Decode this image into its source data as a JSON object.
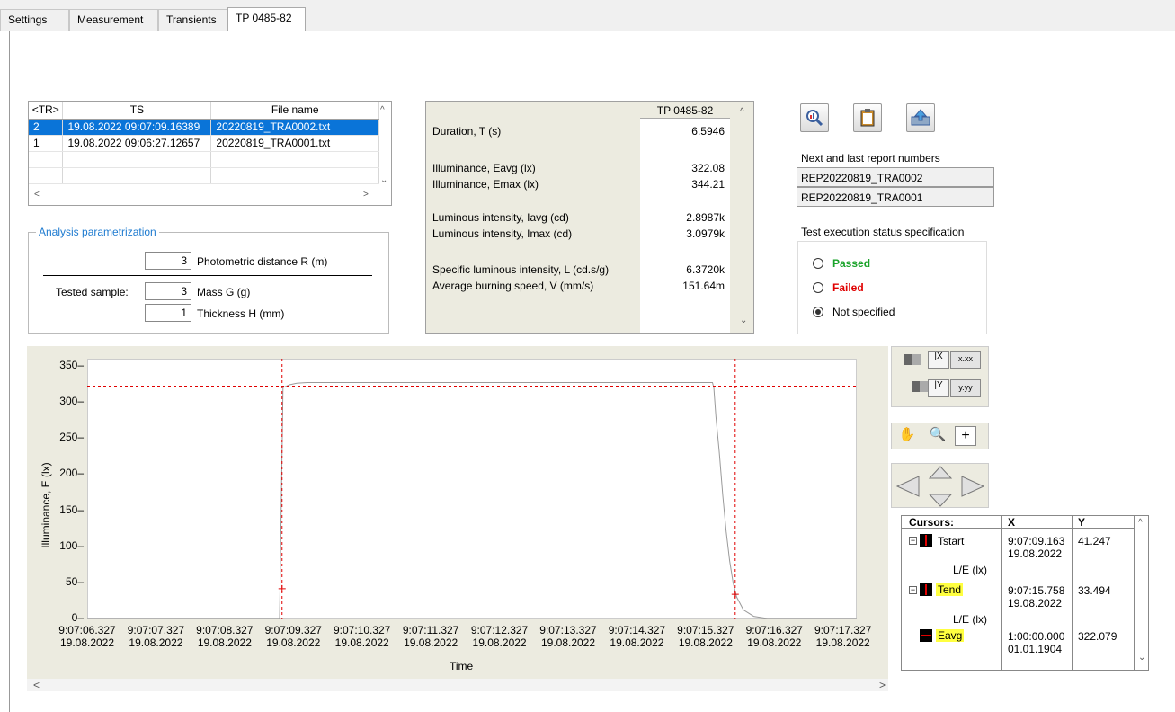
{
  "tabs": [
    "Settings",
    "Measurement",
    "Transients",
    "TP 0485-82"
  ],
  "file_table": {
    "headers": [
      "<TR>",
      "TS",
      "File name"
    ],
    "rows": [
      [
        "2",
        "19.08.2022 09:07:09.16389",
        "20220819_TRA0002.txt"
      ],
      [
        "1",
        "19.08.2022 09:06:27.12657",
        "20220819_TRA0001.txt"
      ]
    ]
  },
  "analysis": {
    "title": "Analysis parametrization",
    "distance_value": "3",
    "distance_label": "Photometric distance R (m)",
    "tested_sample_label": "Tested sample:",
    "mass_value": "3",
    "mass_label": "Mass G (g)",
    "thickness_value": "1",
    "thickness_label": "Thickness H (mm)"
  },
  "results": {
    "header": "TP 0485-82",
    "rows": [
      {
        "label": "Duration, T (s)",
        "value": "6.5946"
      },
      {
        "label": "Illuminance, Eavg (lx)",
        "value": "322.08"
      },
      {
        "label": "Illuminance, Emax (lx)",
        "value": "344.21"
      },
      {
        "label": "Luminous intensity, Iavg (cd)",
        "value": "2.8987k"
      },
      {
        "label": "Luminous intensity, Imax (cd)",
        "value": "3.0979k"
      },
      {
        "label": "Specific luminous intensity, L (cd.s/g)",
        "value": "6.3720k"
      },
      {
        "label": "Average burning speed, V (mm/s)",
        "value": "151.64m"
      }
    ]
  },
  "report": {
    "title": "Next and last report numbers",
    "next": "REP20220819_TRA0002",
    "last": "REP20220819_TRA0001"
  },
  "status": {
    "title": "Test execution status specification",
    "options": [
      "Passed",
      "Failed",
      "Not specified"
    ],
    "selected": "Not specified",
    "passed_color": "#1aa32a",
    "failed_color": "#e00000"
  },
  "plot_controls": {
    "x_format": "x.xx",
    "y_format": "y.yy"
  },
  "cursors": {
    "headers": [
      "Cursors:",
      "X",
      "Y"
    ],
    "items": [
      {
        "name": "Tstart",
        "sub": "L/E (lx)",
        "x_time": "9:07:09.163",
        "x_date": "19.08.2022",
        "y": "41.247"
      },
      {
        "name": "Tend",
        "sub": "L/E (lx)",
        "x_time": "9:07:15.758",
        "x_date": "19.08.2022",
        "y": "33.494"
      },
      {
        "name": "Eavg",
        "sub": "",
        "x_time": "1:00:00.000",
        "x_date": "01.01.1904",
        "y": "322.079"
      }
    ]
  },
  "chart_data": {
    "type": "line",
    "xlabel": "Time",
    "ylabel": "Illuminance, E (lx)",
    "ylim": [
      0,
      360
    ],
    "x_ticks": [
      {
        "t": "9:07:06.327",
        "d": "19.08.2022"
      },
      {
        "t": "9:07:07.327",
        "d": "19.08.2022"
      },
      {
        "t": "9:07:08.327",
        "d": "19.08.2022"
      },
      {
        "t": "9:07:09.327",
        "d": "19.08.2022"
      },
      {
        "t": "9:07:10.327",
        "d": "19.08.2022"
      },
      {
        "t": "9:07:11.327",
        "d": "19.08.2022"
      },
      {
        "t": "9:07:12.327",
        "d": "19.08.2022"
      },
      {
        "t": "9:07:13.327",
        "d": "19.08.2022"
      },
      {
        "t": "9:07:14.327",
        "d": "19.08.2022"
      },
      {
        "t": "9:07:15.327",
        "d": "19.08.2022"
      },
      {
        "t": "9:07:16.327",
        "d": "19.08.2022"
      },
      {
        "t": "9:07:17.327",
        "d": "19.08.2022"
      }
    ],
    "y_ticks": [
      "0",
      "50",
      "100",
      "150",
      "200",
      "250",
      "300",
      "350"
    ],
    "xlim_s": [
      0,
      11.2
    ],
    "series": [
      {
        "x_s": [
          0,
          2.8,
          2.85,
          2.95,
          3.05,
          3.2,
          4.0,
          9.1,
          9.12,
          9.15,
          9.2,
          9.25,
          9.3,
          9.35,
          9.4,
          9.45,
          9.55,
          9.7,
          9.9,
          11.2
        ],
        "y": [
          0,
          0,
          320,
          324,
          326,
          327,
          327,
          327,
          320,
          280,
          230,
          170,
          120,
          80,
          50,
          30,
          12,
          3,
          0,
          0
        ]
      }
    ],
    "cursor_tstart_s": 2.836,
    "cursor_tend_s": 9.431,
    "eavg": 322.079,
    "curve_color": "#9a9a9a",
    "cursor_color": "#e00000"
  }
}
